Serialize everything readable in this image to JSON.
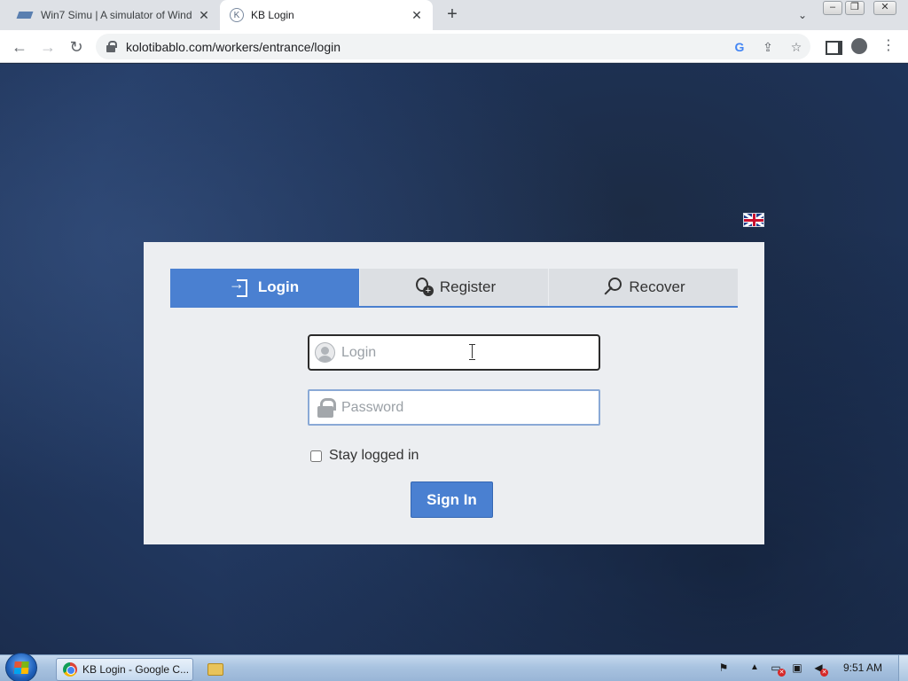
{
  "browser": {
    "tabs": [
      {
        "title": "Win7 Simu | A simulator of Wind",
        "active": false
      },
      {
        "title": "KB Login",
        "active": true
      }
    ],
    "url": "kolotibablo.com/workers/entrance/login",
    "new_tab_icon": "plus-icon",
    "tab_search_icon": "chevron-down-icon"
  },
  "page": {
    "language_flag": "uk-flag-icon",
    "tabs": [
      {
        "label": "Login",
        "icon": "login-icon",
        "active": true
      },
      {
        "label": "Register",
        "icon": "user-add-icon",
        "active": false
      },
      {
        "label": "Recover",
        "icon": "key-icon",
        "active": false
      }
    ],
    "login_field": {
      "placeholder": "Login",
      "value": ""
    },
    "password_field": {
      "placeholder": "Password",
      "value": ""
    },
    "stay_logged_in": {
      "label": "Stay logged in",
      "checked": false
    },
    "sign_in_label": "Sign In",
    "accent_color": "#4a80d1"
  },
  "taskbar": {
    "items": [
      {
        "label": "KB Login - Google C...",
        "icon": "chrome-icon"
      },
      {
        "label": "",
        "icon": "folder-icon"
      }
    ],
    "clock": "9:51 AM"
  }
}
